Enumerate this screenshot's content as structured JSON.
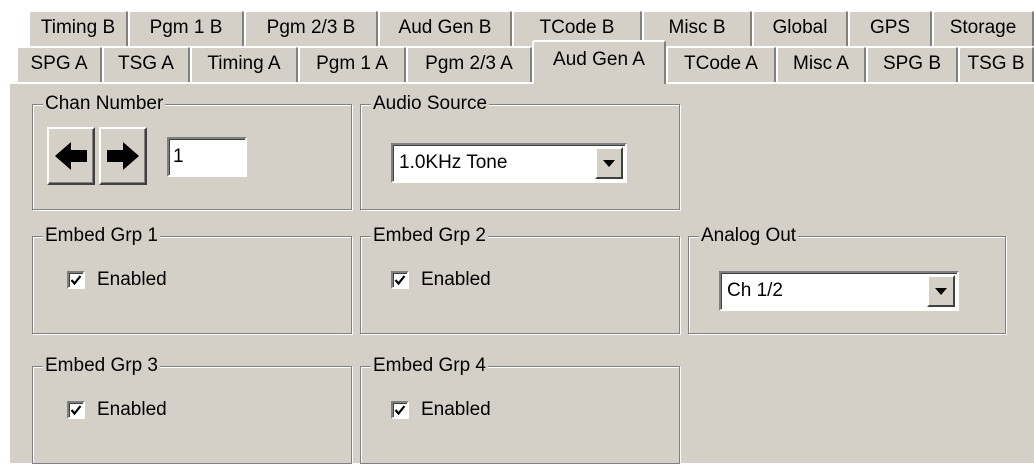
{
  "tabs_row1": [
    {
      "label": "Timing B"
    },
    {
      "label": "Pgm 1 B"
    },
    {
      "label": "Pgm 2/3 B"
    },
    {
      "label": "Aud Gen B"
    },
    {
      "label": "TCode B"
    },
    {
      "label": "Misc B"
    },
    {
      "label": "Global"
    },
    {
      "label": "GPS"
    },
    {
      "label": "Storage"
    }
  ],
  "tabs_row2": [
    {
      "label": "SPG A"
    },
    {
      "label": "TSG A"
    },
    {
      "label": "Timing A"
    },
    {
      "label": "Pgm 1 A"
    },
    {
      "label": "Pgm 2/3 A"
    },
    {
      "label": "Aud Gen A",
      "active": true
    },
    {
      "label": "TCode A"
    },
    {
      "label": "Misc A"
    },
    {
      "label": "SPG B"
    },
    {
      "label": "TSG B"
    }
  ],
  "chan_number": {
    "legend": "Chan Number",
    "value": "1",
    "left_icon": "left-arrow-icon",
    "right_icon": "right-arrow-icon"
  },
  "audio_source": {
    "legend": "Audio Source",
    "selected": "1.0KHz Tone"
  },
  "embed_groups": [
    {
      "legend": "Embed Grp 1",
      "check_label": "Enabled",
      "checked": true
    },
    {
      "legend": "Embed Grp 2",
      "check_label": "Enabled",
      "checked": true
    },
    {
      "legend": "Embed Grp 3",
      "check_label": "Enabled",
      "checked": true
    },
    {
      "legend": "Embed Grp 4",
      "check_label": "Enabled",
      "checked": true
    }
  ],
  "analog_out": {
    "legend": "Analog Out",
    "selected": "Ch 1/2"
  },
  "colors": {
    "panel": "#d4d0c8",
    "shadow": "#808080",
    "highlight": "#ffffff"
  }
}
